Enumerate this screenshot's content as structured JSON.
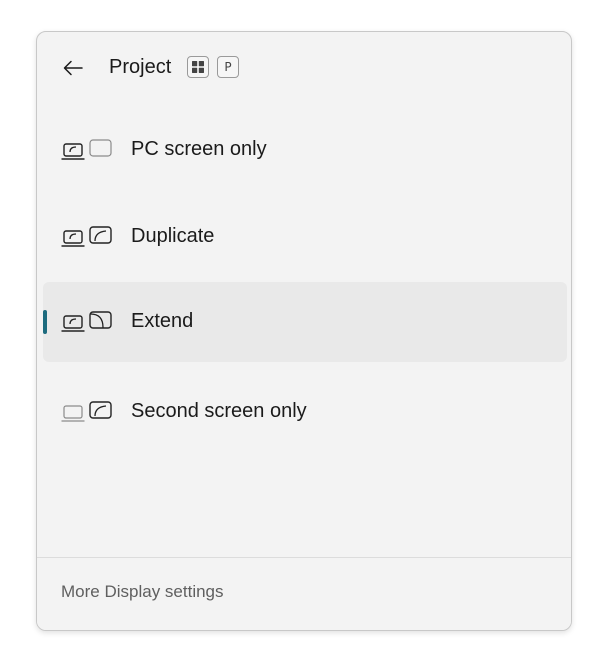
{
  "header": {
    "title": "Project",
    "shortcut_keys": [
      "win-logo-key",
      "P"
    ]
  },
  "options": [
    {
      "label": "PC screen only",
      "icon": "pc-screen-only-icon",
      "selected": false
    },
    {
      "label": "Duplicate",
      "icon": "duplicate-icon",
      "selected": false
    },
    {
      "label": "Extend",
      "icon": "extend-icon",
      "selected": true
    },
    {
      "label": "Second screen only",
      "icon": "second-screen-only-icon",
      "selected": false
    }
  ],
  "footer": {
    "link_label": "More Display settings"
  },
  "colors": {
    "accent": "#1d6b7e",
    "panel_bg": "#f3f3f3",
    "selected_bg": "#e9e9e9"
  }
}
